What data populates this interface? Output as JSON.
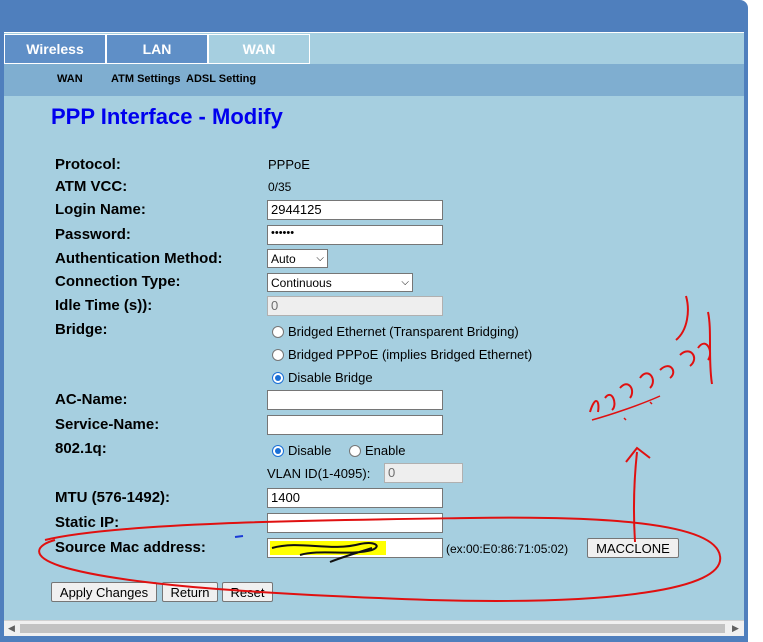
{
  "tabs": [
    "Wireless",
    "LAN",
    "WAN"
  ],
  "subnav": [
    "WAN",
    "ATM Settings",
    "ADSL Setting"
  ],
  "page_title": "PPP Interface - Modify",
  "form": {
    "protocol_label": "Protocol:",
    "protocol_value": "PPPoE",
    "atm_vcc_label": "ATM VCC:",
    "atm_vcc_value": "0/35",
    "login_label": "Login Name:",
    "login_value": "2944125",
    "password_label": "Password:",
    "password_value": "••••••",
    "auth_label": "Authentication Method:",
    "auth_value": "Auto",
    "conn_label": "Connection Type:",
    "conn_value": "Continuous",
    "idle_label": "Idle Time (s)):",
    "idle_value": "0",
    "bridge_label": "Bridge:",
    "bridge_opt1": "Bridged Ethernet (Transparent Bridging)",
    "bridge_opt2": "Bridged PPPoE (implies Bridged Ethernet)",
    "bridge_opt3": "Disable Bridge",
    "ac_label": "AC-Name:",
    "service_label": "Service-Name:",
    "dot1q_label": "802.1q:",
    "dot1q_disable": "Disable",
    "dot1q_enable": "Enable",
    "vlan_label": "VLAN ID(1-4095):",
    "vlan_value": "0",
    "mtu_label": "MTU (576-1492):",
    "mtu_value": "1400",
    "static_ip_label": "Static IP:",
    "mac_label": "Source Mac address:",
    "mac_hint": "(ex:00:E0:86:71:05:02)",
    "macclone_label": "MACCLONE"
  },
  "buttons": {
    "apply": "Apply Changes",
    "return": "Return",
    "reset": "Reset"
  },
  "colors": {
    "frame": "#4f7fbd",
    "panel": "#a6cfe0",
    "title": "#0000ee",
    "annotation": "#e01010",
    "highlight": "#ffff00"
  }
}
